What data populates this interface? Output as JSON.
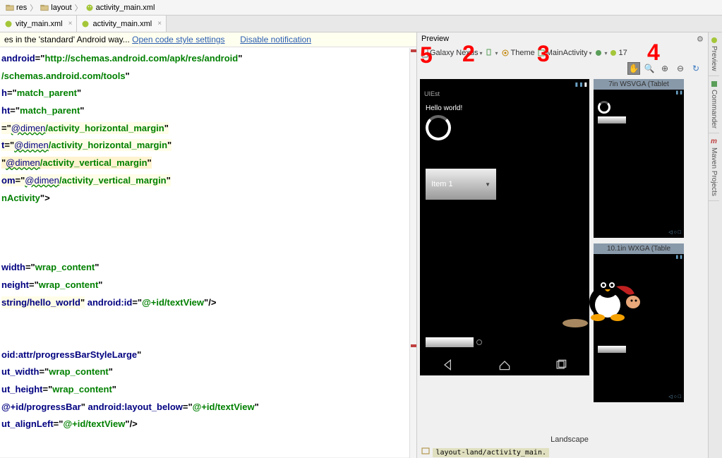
{
  "breadcrumb": [
    {
      "icon": "folder",
      "label": "res"
    },
    {
      "icon": "folder",
      "label": "layout"
    },
    {
      "icon": "android",
      "label": "activity_main.xml"
    }
  ],
  "tabs": [
    {
      "label": "vity_main.xml",
      "icon": "android"
    },
    {
      "label": "activity_main.xml",
      "icon": "android"
    }
  ],
  "notice": {
    "prefix": "es in the 'standard' Android way...  ",
    "link1": "Open code style settings",
    "link2": "Disable notification"
  },
  "code_lines": [
    {
      "html": "<span class='attr-n'>android</span><span class='eq'>=</span><span class='q'>\"</span><span class='attr-v'>http://schemas.android.com/apk/res/android</span><span class='q'>\"</span>"
    },
    {
      "html": "<span class='attr-v'>/schemas.android.com/tools</span><span class='q'>\"</span>"
    },
    {
      "html": "<span class='attr-n'>h</span><span class='eq'>=</span><span class='q'>\"</span><span class='attr-v'>match_parent</span><span class='q'>\"</span>"
    },
    {
      "html": "<span class='attr-n'>ht</span><span class='eq'>=</span><span class='q'>\"</span><span class='attr-v'>match_parent</span><span class='q'>\"</span>"
    },
    {
      "html": "<span class='hl'><span class='eq'>=</span><span class='q'>\"</span><span class='dim-link'>@dimen</span><span class='attr-v'>/activity_horizontal_margin</span><span class='q'>\"</span></span>"
    },
    {
      "html": "<span class='hl'><span class='attr-n'>t</span><span class='eq'>=</span><span class='q'>\"</span><span class='dim-link'>@dimen</span><span class='attr-v'>/activity_horizontal_margin</span><span class='q'>\"</span></span>"
    },
    {
      "html": "<span class='hl2'><span class='q'>\"</span><span class='dim-link'>@dimen</span><span class='attr-v'>/activity_vertical_margin</span><span class='q'>\"</span></span>"
    },
    {
      "html": "<span class='hl'><span class='attr-n'>om</span><span class='eq'>=</span><span class='q'>\"</span><span class='dim-link'>@dimen</span><span class='attr-v'>/activity_vertical_margin</span><span class='q'>\"</span></span>"
    },
    {
      "html": "<span class='attr-v'>nActivity</span><span class='q'>\"</span><span class='tag-end'>&gt;</span>"
    },
    {
      "html": ""
    },
    {
      "html": ""
    },
    {
      "html": ""
    },
    {
      "html": "<span class='attr-n'>width</span><span class='eq'>=</span><span class='q'>\"</span><span class='attr-v'>wrap_content</span><span class='q'>\"</span>"
    },
    {
      "html": "<span class='attr-n'>neight</span><span class='eq'>=</span><span class='q'>\"</span><span class='attr-v'>wrap_content</span><span class='q'>\"</span>"
    },
    {
      "html": "<span class='hl'><span class='attr-n'>string/hello_world</span><span class='q'>\"</span></span> <span class='attr-n'>android:id</span><span class='eq'>=</span><span class='q'>\"</span><span class='attr-v'>@+id/textView</span><span class='q'>\"</span><span class='tag-end'>/&gt;</span>"
    },
    {
      "html": ""
    },
    {
      "html": ""
    },
    {
      "html": "<span class='attr-n'>oid:attr/progressBarStyleLarge</span><span class='q'>\"</span>"
    },
    {
      "html": "<span class='attr-n'>ut_width</span><span class='eq'>=</span><span class='q'>\"</span><span class='attr-v'>wrap_content</span><span class='q'>\"</span>"
    },
    {
      "html": "<span class='attr-n'>ut_height</span><span class='eq'>=</span><span class='q'>\"</span><span class='attr-v'>wrap_content</span><span class='q'>\"</span>"
    },
    {
      "html": "<span class='attr-n'>@+id/progressBar</span><span class='q'>\"</span> <span class='attr-n'>android:layout_below</span><span class='eq'>=</span><span class='q'>\"</span><span class='attr-v'>@+id/textView</span><span class='q'>\"</span>"
    },
    {
      "html": "<span class='attr-n'>ut_alignLeft</span><span class='eq'>=</span><span class='q'>\"</span><span class='attr-v'>@+id/textView</span><span class='q'>\"</span><span class='tag-end'>/&gt;</span>"
    }
  ],
  "preview": {
    "title": "Preview",
    "device": "Galaxy Nexus",
    "theme": "Theme",
    "activity": "MainActivity",
    "api": "17",
    "footer_orient": "Landscape",
    "footer_path": "layout-land/activity_main."
  },
  "app": {
    "title": "UIEst",
    "hello": "Hello world!",
    "spinner_item": "Item 1"
  },
  "small_devices": [
    "7in WSVGA (Tablet",
    "10.1in WXGA (Table"
  ],
  "annotations": {
    "a5": "5",
    "a2": "2",
    "a3": "3",
    "a4": "4"
  },
  "sidebar_tabs": [
    "Preview",
    "Commander",
    "Maven Projects"
  ]
}
